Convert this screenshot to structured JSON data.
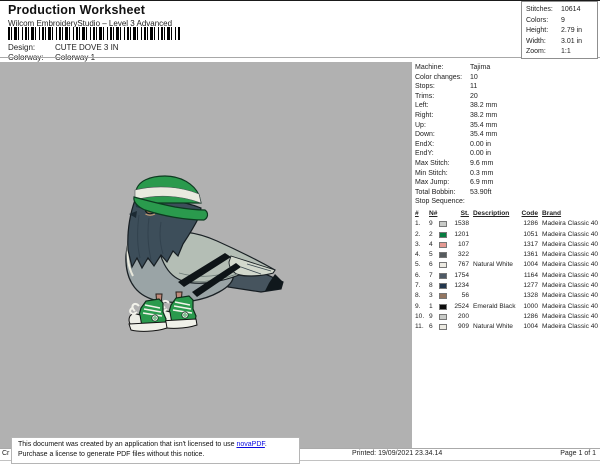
{
  "header": {
    "title": "Production Worksheet",
    "subtitle": "Wilcom EmbroideryStudio – Level 3 Advanced",
    "design_label": "Design:",
    "design_value": "CUTE DOVE 3 IN",
    "colorway_label": "Colorway:",
    "colorway_value": "Colorway 1"
  },
  "summary": {
    "rows": [
      {
        "label": "Stitches:",
        "value": "10614"
      },
      {
        "label": "Colors:",
        "value": "9"
      },
      {
        "label": "Height:",
        "value": "2.79 in"
      },
      {
        "label": "Width:",
        "value": "3.01 in"
      },
      {
        "label": "Zoom:",
        "value": "1:1"
      }
    ]
  },
  "machine_info": {
    "rows": [
      {
        "label": "Machine:",
        "value": "Tajima"
      },
      {
        "label": "Color changes:",
        "value": "10"
      },
      {
        "label": "Stops:",
        "value": "11"
      },
      {
        "label": "Trims:",
        "value": "20"
      },
      {
        "label": "Left:",
        "value": "38.2 mm"
      },
      {
        "label": "Right:",
        "value": "38.2 mm"
      },
      {
        "label": "Up:",
        "value": "35.4 mm"
      },
      {
        "label": "Down:",
        "value": "35.4 mm"
      },
      {
        "label": "EndX:",
        "value": "0.00 in"
      },
      {
        "label": "EndY:",
        "value": "0.00 in"
      },
      {
        "label": "Max Stitch:",
        "value": "9.6 mm"
      },
      {
        "label": "Min Stitch:",
        "value": "0.3 mm"
      },
      {
        "label": "Max Jump:",
        "value": "6.9 mm"
      },
      {
        "label": "Total Bobbin:",
        "value": "53.90ft"
      }
    ]
  },
  "stop_sequence": {
    "title": "Stop Sequence:",
    "columns": [
      "#",
      "N#",
      "St.",
      "Description",
      "Code",
      "Brand"
    ],
    "rows": [
      {
        "num": "1.",
        "n": "9",
        "swatch": "#c9cbc8",
        "st": "1538",
        "description": "",
        "code": "1286",
        "brand": "Madeira Classic 40"
      },
      {
        "num": "2.",
        "n": "2",
        "swatch": "#077d41",
        "st": "1201",
        "description": "",
        "code": "1051",
        "brand": "Madeira Classic 40"
      },
      {
        "num": "3.",
        "n": "4",
        "swatch": "#e59a93",
        "st": "107",
        "description": "",
        "code": "1317",
        "brand": "Madeira Classic 40"
      },
      {
        "num": "4.",
        "n": "5",
        "swatch": "#565b5e",
        "st": "322",
        "description": "",
        "code": "1361",
        "brand": "Madeira Classic 40"
      },
      {
        "num": "5.",
        "n": "6",
        "swatch": "#eceae2",
        "st": "767",
        "description": "Natural White",
        "code": "1004",
        "brand": "Madeira Classic 40"
      },
      {
        "num": "6.",
        "n": "7",
        "swatch": "#4e5a66",
        "st": "1754",
        "description": "",
        "code": "1164",
        "brand": "Madeira Classic 40"
      },
      {
        "num": "7.",
        "n": "8",
        "swatch": "#23374e",
        "st": "1234",
        "description": "",
        "code": "1277",
        "brand": "Madeira Classic 40"
      },
      {
        "num": "8.",
        "n": "3",
        "swatch": "#937560",
        "st": "56",
        "description": "",
        "code": "1328",
        "brand": "Madeira Classic 40"
      },
      {
        "num": "9.",
        "n": "1",
        "swatch": "#0d0d0d",
        "st": "2524",
        "description": "Emerald Black",
        "code": "1000",
        "brand": "Madeira Classic 40"
      },
      {
        "num": "10.",
        "n": "9",
        "swatch": "#c9cbc8",
        "st": "200",
        "description": "",
        "code": "1286",
        "brand": "Madeira Classic 40"
      },
      {
        "num": "11.",
        "n": "6",
        "swatch": "#eceae2",
        "st": "909",
        "description": "Natural White",
        "code": "1004",
        "brand": "Madeira Classic 40"
      }
    ]
  },
  "notice": {
    "text_before_link": "This document was created by an application that isn't licensed to use ",
    "link_text": "novaPDF",
    "text_after_link": ".",
    "line2": "Purchase a license to generate PDF files without this notice."
  },
  "footer": {
    "left_fragment": "Cr",
    "printed": "Printed: 19/09/2021 23.34.14",
    "page": "Page 1 of 1"
  },
  "design_preview": {
    "subject": "pigeon wearing green bucket hat and green sneakers"
  },
  "colors": {
    "canvas_gray": "#b1b1b1",
    "hat_green": "#2a9a4d",
    "link_blue": "#0a0ae0"
  }
}
